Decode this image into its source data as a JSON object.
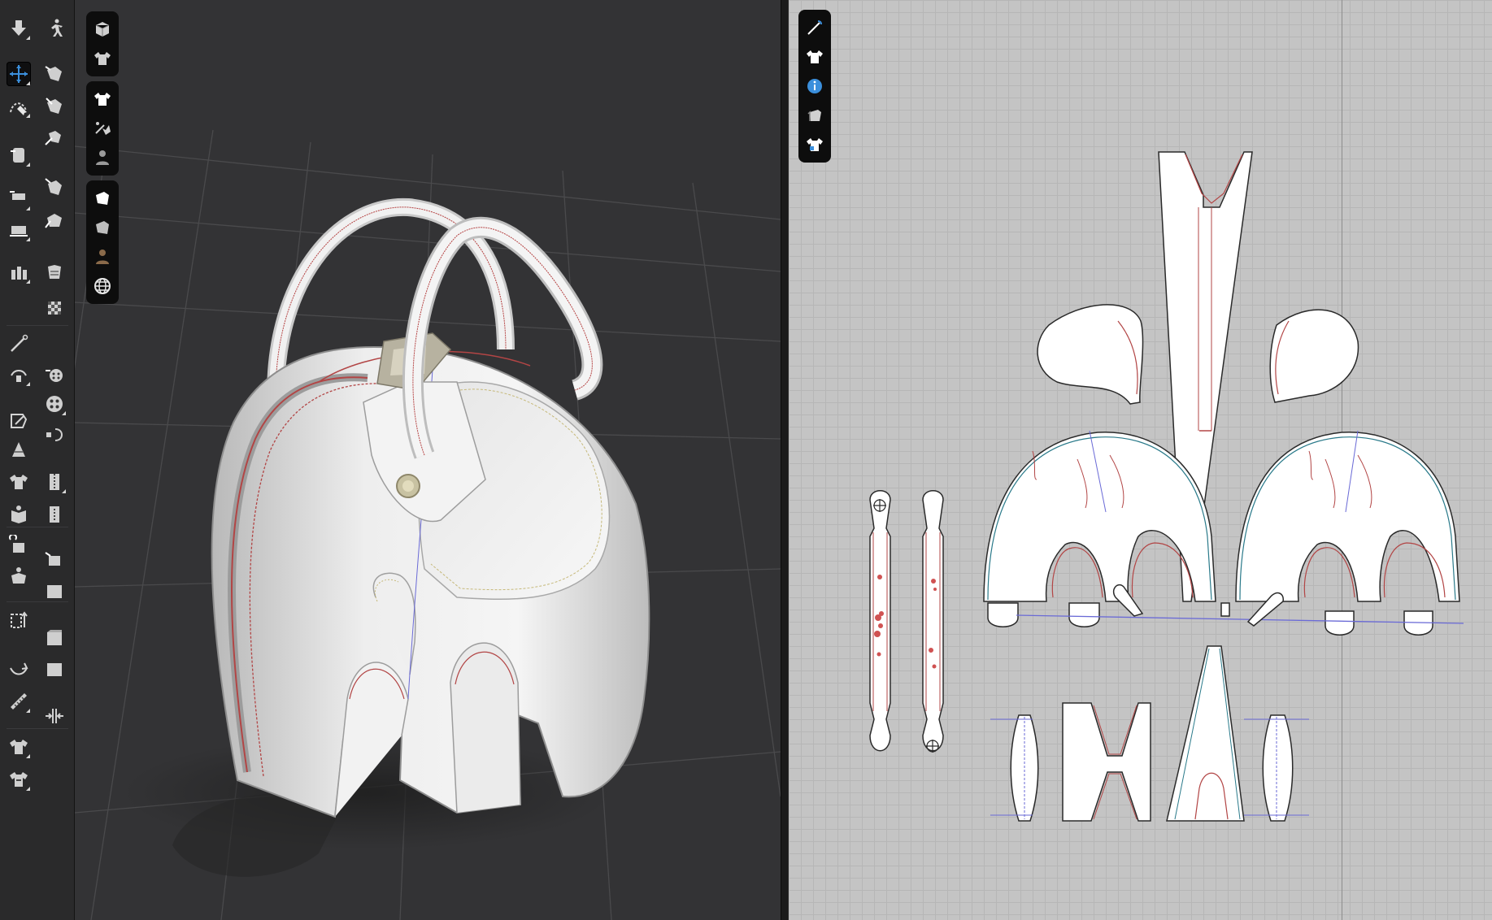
{
  "app": {
    "accent_color": "#3b8fdc",
    "panel_color": "#2a2a2b",
    "viewport_color": "#333335",
    "pattern_bg_color": "#c4c4c4"
  },
  "tool_palette": {
    "tools": [
      {
        "name": "drop-icon",
        "active": false
      },
      {
        "name": "simulate-icon",
        "active": false
      },
      {
        "name": "transform-gizmo-icon",
        "active": true
      },
      {
        "name": "fold-arrangement-icon",
        "active": false
      },
      {
        "name": "edit-curve-icon",
        "active": false
      },
      {
        "name": "segment-sewing-icon",
        "active": false
      },
      {
        "name": "arrangement-icon",
        "active": false
      },
      {
        "name": "free-sewing-icon",
        "active": false
      },
      {
        "name": "select-mesh-icon",
        "active": false
      },
      {
        "name": "tack-icon",
        "active": false
      },
      {
        "name": "brush-icon",
        "active": false
      },
      {
        "name": "pin-icon",
        "active": false
      },
      {
        "name": "texture-icon",
        "active": false
      },
      {
        "name": "button-icon",
        "active": false
      },
      {
        "name": "buttonhole-icon",
        "active": false
      },
      {
        "name": "zipper-icon",
        "active": false
      },
      {
        "name": "puckering-icon",
        "active": false
      },
      {
        "name": "elastic-icon",
        "active": false
      },
      {
        "name": "trim-icon",
        "active": false
      },
      {
        "name": "measure-icon",
        "active": false
      },
      {
        "name": "avatar-measure-icon",
        "active": false
      }
    ]
  },
  "viewport_3d": {
    "toolbar_groups": [
      {
        "items": [
          "cube-icon",
          "avatar-garment-icon"
        ]
      },
      {
        "items": [
          "garment-icon",
          "sewing-lines-icon",
          "avatar-icon"
        ]
      },
      {
        "items": [
          "fabric-icon",
          "texture-view-icon",
          "skin-icon",
          "global-icon"
        ]
      }
    ]
  },
  "pattern_2d": {
    "toolbar_items": [
      "needle-icon",
      "shirt-icon",
      "info-icon",
      "layers-icon",
      "shirt-lock-icon"
    ]
  }
}
